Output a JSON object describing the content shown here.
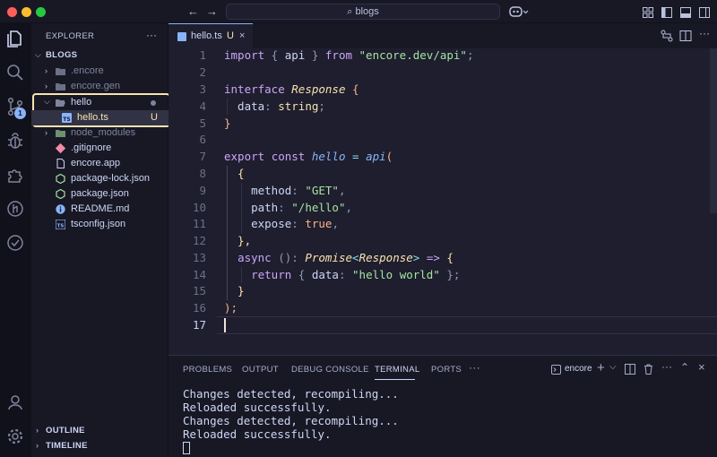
{
  "titlebar": {
    "search_text": "blogs",
    "colors": {
      "close": "#ff5f57",
      "minimize": "#febc2e",
      "zoom": "#28c840"
    }
  },
  "activity_bar": {
    "items": [
      "explorer-icon",
      "search-icon",
      "source-control-icon",
      "run-debug-icon",
      "extensions-icon",
      "remote-icon",
      "testing-icon",
      "account-icon",
      "settings-icon"
    ],
    "source_control_badge": "1"
  },
  "sidebar": {
    "title": "EXPLORER",
    "more": "···",
    "root": "BLOGS",
    "items": [
      {
        "label": ".encore",
        "type": "folder",
        "dim": true
      },
      {
        "label": "encore.gen",
        "type": "folder",
        "dim": true
      },
      {
        "label": "hello",
        "type": "folder-open"
      },
      {
        "label": "hello.ts",
        "type": "ts",
        "status": "U"
      },
      {
        "label": "node_modules",
        "type": "folder",
        "dim": true
      },
      {
        "label": ".gitignore",
        "type": "git"
      },
      {
        "label": "encore.app",
        "type": "file"
      },
      {
        "label": "package-lock.json",
        "type": "json"
      },
      {
        "label": "package.json",
        "type": "json"
      },
      {
        "label": "README.md",
        "type": "info"
      },
      {
        "label": "tsconfig.json",
        "type": "ts-config"
      }
    ],
    "outline": "OUTLINE",
    "timeline": "TIMELINE",
    "highlight_color": "#f9e2af"
  },
  "editor": {
    "tab_label": "hello.ts",
    "tab_status": "U",
    "line_numbers": [
      "1",
      "2",
      "3",
      "4",
      "5",
      "6",
      "7",
      "8",
      "9",
      "10",
      "11",
      "12",
      "13",
      "14",
      "15",
      "16",
      "17"
    ],
    "code": {
      "l1": {
        "a": "import",
        "b": " { ",
        "c": "api",
        "d": " } ",
        "e": "from",
        "f": " ",
        "g": "\"encore.dev/api\"",
        "h": ";"
      },
      "l3": {
        "a": "interface",
        "b": " ",
        "c": "Response",
        "d": " {"
      },
      "l4": {
        "a": "  data",
        "b": ": ",
        "c": "string",
        "d": ";"
      },
      "l5": {
        "a": "}"
      },
      "l7": {
        "a": "export",
        "b": " ",
        "c": "const",
        "d": " ",
        "e": "hello",
        "f": " = ",
        "g": "api",
        "h": "("
      },
      "l8": {
        "a": "  {"
      },
      "l9": {
        "a": "    method",
        "b": ": ",
        "c": "\"GET\"",
        "d": ","
      },
      "l10": {
        "a": "    path",
        "b": ": ",
        "c": "\"/hello\"",
        "d": ","
      },
      "l11": {
        "a": "    expose",
        "b": ": ",
        "c": "true",
        "d": ","
      },
      "l12": {
        "a": "  },"
      },
      "l13": {
        "a": "  ",
        "b": "async",
        "c": " (): ",
        "d": "Promise",
        "e": "<",
        "f": "Response",
        "g": ">",
        "h": " => ",
        "i": "{"
      },
      "l14": {
        "a": "    ",
        "b": "return",
        "c": " { ",
        "d": "data",
        "e": ": ",
        "f": "\"hello world\"",
        "g": " };"
      },
      "l15": {
        "a": "  }"
      },
      "l16": {
        "a": ");"
      }
    }
  },
  "panel": {
    "tabs": [
      "PROBLEMS",
      "OUTPUT",
      "DEBUG CONSOLE",
      "TERMINAL",
      "PORTS",
      "···"
    ],
    "active_tab": "TERMINAL",
    "terminal_name": "encore",
    "terminal_lines": [
      "Changes detected, recompiling...",
      "Reloaded successfully.",
      "Changes detected, recompiling...",
      "Reloaded successfully."
    ]
  }
}
